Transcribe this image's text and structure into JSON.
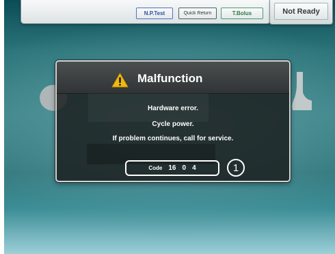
{
  "toolbar": {
    "np_test": "N.P.Test",
    "quick_return": "Quick Return",
    "t_bolus": "T.Bolus",
    "status": "Not Ready"
  },
  "dialog": {
    "title": "Malfunction",
    "title_icon": "warning-triangle-icon",
    "messages": [
      "Hardware error.",
      "Cycle power.",
      "If problem continues, call for service."
    ],
    "code_label": "Code",
    "code_values": [
      "16",
      "0",
      "4"
    ],
    "callout": "1"
  },
  "colors": {
    "background_teal": "#3a8287",
    "dialog_bg": "#1f2222",
    "warning_yellow": "#f2b90f",
    "np_test_blue": "#2e4ea4",
    "t_bolus_green": "#2b7a48"
  }
}
